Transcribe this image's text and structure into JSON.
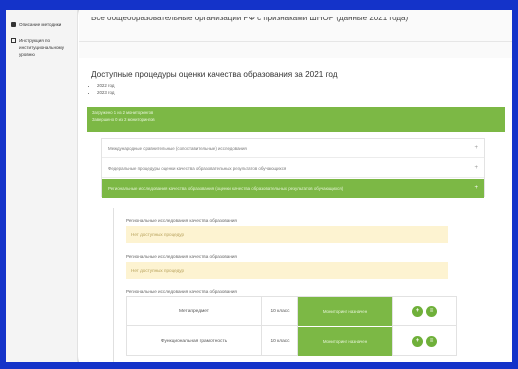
{
  "colors": {
    "frame": "#1433c9",
    "accent_green": "#7cb845",
    "warning_bg": "#fdf3d1"
  },
  "sidebar": {
    "items": [
      {
        "label": "Описание методики",
        "icon": "book-icon"
      },
      {
        "label": "Инструкция по институциональному уровню",
        "icon": "document-icon"
      }
    ]
  },
  "header": {
    "title": "Все общеобразовательные организации РФ с признаками ШНОР (данные 2021 года)"
  },
  "main": {
    "section_title": "Доступные процедуры оценки качества образования за 2021 год",
    "years": [
      "2022 год",
      "2023 год"
    ],
    "status_lines": [
      "Загружено 1 из 2 мониторингов",
      "Завершено 0 из 2 мониторингов"
    ],
    "accordion": [
      {
        "label": "Международные сравнительные (сопоставительные) исследования",
        "toggle": "+"
      },
      {
        "label": "Федеральные процедуры оценки качества образовательных результатов обучающихся",
        "toggle": "+"
      },
      {
        "label": "Региональные исследования качества образования (оценки качества образовательных результатов обучающихся)",
        "toggle": "+"
      }
    ],
    "panel": {
      "groups": [
        {
          "label": "Региональные исследования качества образования",
          "notice": "Нет доступных процедур"
        },
        {
          "label": "Региональные исследования качества образования",
          "notice": "Нет доступных процедур"
        }
      ],
      "table_label": "Региональные исследования качества образования",
      "rows": [
        {
          "subject": "Метапредмет",
          "grade": "10 класс",
          "status": "Мониторинг назначен",
          "btn_add": "+",
          "btn_more": "≡"
        },
        {
          "subject": "Функциональная грамотность",
          "grade": "10 класс",
          "status": "Мониторинг назначен",
          "btn_add": "+",
          "btn_more": "≡"
        }
      ]
    }
  }
}
